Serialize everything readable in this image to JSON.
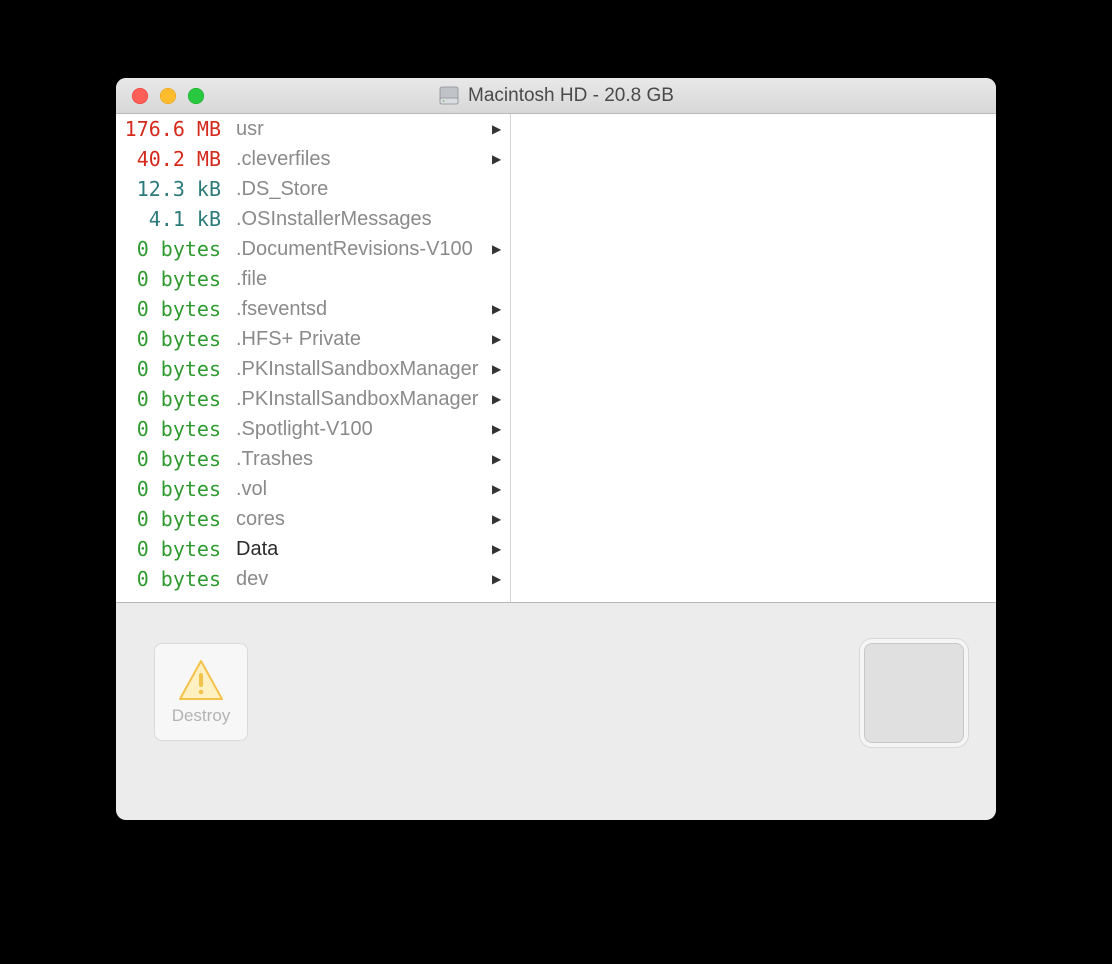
{
  "window": {
    "title": "Macintosh HD - 20.8 GB"
  },
  "files": [
    {
      "size": "176.6 MB",
      "sizeClass": "red",
      "name": "usr",
      "nameDim": true,
      "hasChevron": true
    },
    {
      "size": "40.2 MB",
      "sizeClass": "red",
      "name": ".cleverfiles",
      "nameDim": true,
      "hasChevron": true
    },
    {
      "size": "12.3 kB",
      "sizeClass": "teal",
      "name": ".DS_Store",
      "nameDim": true,
      "hasChevron": false
    },
    {
      "size": "4.1 kB",
      "sizeClass": "teal",
      "name": ".OSInstallerMessages",
      "nameDim": true,
      "hasChevron": false
    },
    {
      "size": "0 bytes",
      "sizeClass": "green",
      "name": ".DocumentRevisions-V100",
      "nameDim": true,
      "hasChevron": true
    },
    {
      "size": "0 bytes",
      "sizeClass": "green",
      "name": ".file",
      "nameDim": true,
      "hasChevron": false
    },
    {
      "size": "0 bytes",
      "sizeClass": "green",
      "name": ".fseventsd",
      "nameDim": true,
      "hasChevron": true
    },
    {
      "size": "0 bytes",
      "sizeClass": "green",
      "name": ".HFS+ Private",
      "nameDim": true,
      "hasChevron": true
    },
    {
      "size": "0 bytes",
      "sizeClass": "green",
      "name": ".PKInstallSandboxManager",
      "nameDim": true,
      "hasChevron": true
    },
    {
      "size": "0 bytes",
      "sizeClass": "green",
      "name": ".PKInstallSandboxManager",
      "nameDim": true,
      "hasChevron": true
    },
    {
      "size": "0 bytes",
      "sizeClass": "green",
      "name": ".Spotlight-V100",
      "nameDim": true,
      "hasChevron": true
    },
    {
      "size": "0 bytes",
      "sizeClass": "green",
      "name": ".Trashes",
      "nameDim": true,
      "hasChevron": true
    },
    {
      "size": "0 bytes",
      "sizeClass": "green",
      "name": ".vol",
      "nameDim": true,
      "hasChevron": true
    },
    {
      "size": "0 bytes",
      "sizeClass": "green",
      "name": "cores",
      "nameDim": true,
      "hasChevron": true
    },
    {
      "size": "0 bytes",
      "sizeClass": "green",
      "name": "Data",
      "nameDim": false,
      "hasChevron": true
    },
    {
      "size": "0 bytes",
      "sizeClass": "green",
      "name": "dev",
      "nameDim": true,
      "hasChevron": true
    }
  ],
  "toolbar": {
    "destroy_label": "Destroy"
  }
}
